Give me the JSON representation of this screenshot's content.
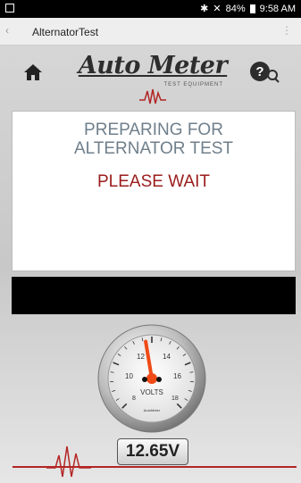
{
  "status": {
    "battery": "84%",
    "time": "9:58 AM"
  },
  "actionbar": {
    "title": "AlternatorTest"
  },
  "logo": {
    "brand": "Auto Meter",
    "sub": "TEST EQUIPMENT"
  },
  "panel": {
    "line1": "PREPARING FOR",
    "line2": "ALTERNATOR TEST",
    "line3": "PLEASE WAIT"
  },
  "gauge": {
    "ticks": [
      "10",
      "12",
      "14",
      "16",
      "18",
      "8"
    ],
    "unit": "VOLTS",
    "brand": "AutoMeter",
    "needle_value": 12.65
  },
  "readout": {
    "value": "12.65V"
  },
  "colors": {
    "accent_red": "#b32525",
    "title_gray": "#6f7f8b",
    "wait_red": "#9b1c1c",
    "needle": "#f04a16"
  }
}
